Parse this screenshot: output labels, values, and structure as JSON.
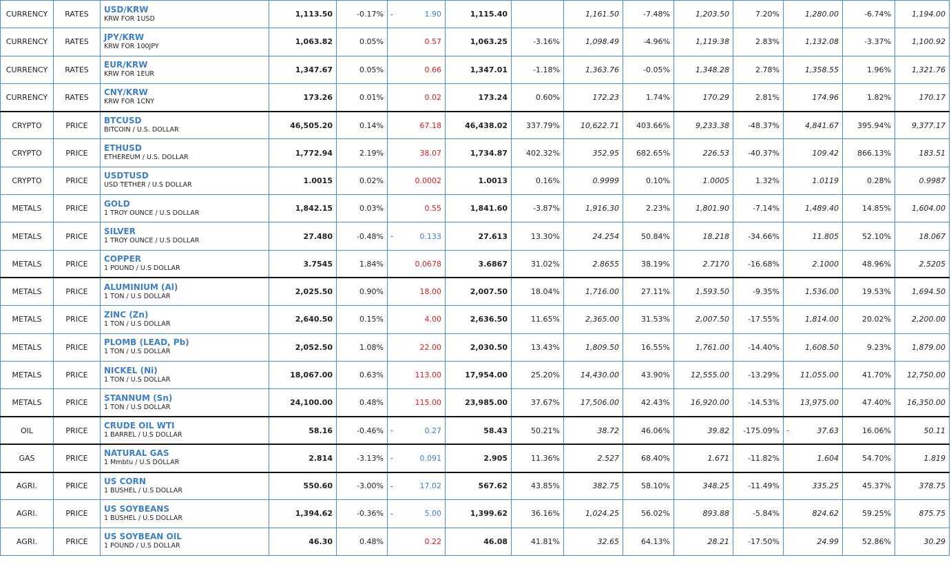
{
  "colors": {
    "positive": "#e0191e",
    "negative": "#3d7fc9",
    "name": "#3d7fc9",
    "grid": "#4a8fd6"
  },
  "rows": [
    {
      "cat": "CURRENCY",
      "kind": "RATES",
      "name": "USD/KRW",
      "sub": "KRW FOR 1USD",
      "price": "1,113.50",
      "chg_pct": "-0.17%",
      "chg_dash": "-",
      "chg": "1.90",
      "prev": "1,115.40",
      "p1_pct": "",
      "p1_val": "1,161.50",
      "p2_pct": "-7.48%",
      "p2_dash": "",
      "p2_val": "1,203.50",
      "p3_pct": "7.20%",
      "p3_dash": "",
      "p3_val": "1,280.00",
      "p4_pct": "-6.74%",
      "p4_val": "1,194.00",
      "sep": false
    },
    {
      "cat": "CURRENCY",
      "kind": "RATES",
      "name": "JPY/KRW",
      "sub": "KRW FOR 100JPY",
      "price": "1,063.82",
      "chg_pct": "0.05%",
      "chg_dash": "",
      "chg": "0.57",
      "prev": "1,063.25",
      "p1_pct": "-3.16%",
      "p1_val": "1,098.49",
      "p2_pct": "-4.96%",
      "p2_dash": "",
      "p2_val": "1,119.38",
      "p3_pct": "2.83%",
      "p3_dash": "",
      "p3_val": "1,132.08",
      "p4_pct": "-3.37%",
      "p4_val": "1,100.92",
      "sep": false
    },
    {
      "cat": "CURRENCY",
      "kind": "RATES",
      "name": "EUR/KRW",
      "sub": "KRW FOR 1EUR",
      "price": "1,347.67",
      "chg_pct": "0.05%",
      "chg_dash": "",
      "chg": "0.66",
      "prev": "1,347.01",
      "p1_pct": "-1.18%",
      "p1_val": "1,363.76",
      "p2_pct": "-0.05%",
      "p2_dash": "",
      "p2_val": "1,348.28",
      "p3_pct": "2.78%",
      "p3_dash": "",
      "p3_val": "1,358.55",
      "p4_pct": "1.96%",
      "p4_val": "1,321.76",
      "sep": false
    },
    {
      "cat": "CURRENCY",
      "kind": "RATES",
      "name": "CNY/KRW",
      "sub": "KRW FOR 1CNY",
      "price": "173.26",
      "chg_pct": "0.01%",
      "chg_dash": "",
      "chg": "0.02",
      "prev": "173.24",
      "p1_pct": "0.60%",
      "p1_val": "172.23",
      "p2_pct": "1.74%",
      "p2_dash": "",
      "p2_val": "170.29",
      "p3_pct": "2.81%",
      "p3_dash": "",
      "p3_val": "174.96",
      "p4_pct": "1.82%",
      "p4_val": "170.17",
      "sep": false
    },
    {
      "cat": "CRYPTO",
      "kind": "PRICE",
      "name": "BTCUSD",
      "sub": "BITCOIN / U.S. DOLLAR",
      "price": "46,505.20",
      "chg_pct": "0.14%",
      "chg_dash": "",
      "chg": "67.18",
      "prev": "46,438.02",
      "p1_pct": "337.79%",
      "p1_val": "10,622.71",
      "p2_pct": "403.66%",
      "p2_dash": "",
      "p2_val": "9,233.38",
      "p3_pct": "-48.37%",
      "p3_dash": "",
      "p3_val": "4,841.67",
      "p4_pct": "395.94%",
      "p4_val": "9,377.17",
      "sep": true
    },
    {
      "cat": "CRYPTO",
      "kind": "PRICE",
      "name": "ETHUSD",
      "sub": "ETHEREUM / U.S. DOLLAR",
      "price": "1,772.94",
      "chg_pct": "2.19%",
      "chg_dash": "",
      "chg": "38.07",
      "prev": "1,734.87",
      "p1_pct": "402.32%",
      "p1_val": "352.95",
      "p2_pct": "682.65%",
      "p2_dash": "",
      "p2_val": "226.53",
      "p3_pct": "-40.37%",
      "p3_dash": "",
      "p3_val": "109.42",
      "p4_pct": "866.13%",
      "p4_val": "183.51",
      "sep": false
    },
    {
      "cat": "CRYPTO",
      "kind": "PRICE",
      "name": "USDTUSD",
      "sub": "USD TETHER / U.S DOLLAR",
      "price": "1.0015",
      "chg_pct": "0.02%",
      "chg_dash": "",
      "chg": "0.0002",
      "prev": "1.0013",
      "p1_pct": "0.16%",
      "p1_val": "0.9999",
      "p2_pct": "0.10%",
      "p2_dash": "",
      "p2_val": "1.0005",
      "p3_pct": "1.32%",
      "p3_dash": "",
      "p3_val": "1.0119",
      "p4_pct": "0.28%",
      "p4_val": "0.9987",
      "sep": false
    },
    {
      "cat": "METALS",
      "kind": "PRICE",
      "name": "GOLD",
      "sub": "1 TROY OUNCE / U.S DOLLAR",
      "price": "1,842.15",
      "chg_pct": "0.03%",
      "chg_dash": "",
      "chg": "0.55",
      "prev": "1,841.60",
      "p1_pct": "-3.87%",
      "p1_val": "1,916.30",
      "p2_pct": "2.23%",
      "p2_dash": "",
      "p2_val": "1,801.90",
      "p3_pct": "-7.14%",
      "p3_dash": "",
      "p3_val": "1,489.40",
      "p4_pct": "14.85%",
      "p4_val": "1,604.00",
      "sep": false
    },
    {
      "cat": "METALS",
      "kind": "PRICE",
      "name": "SILVER",
      "sub": "1 TROY OUNCE / U.S DOLLAR",
      "price": "27.480",
      "chg_pct": "-0.48%",
      "chg_dash": "-",
      "chg": "0.133",
      "prev": "27.613",
      "p1_pct": "13.30%",
      "p1_val": "24.254",
      "p2_pct": "50.84%",
      "p2_dash": "",
      "p2_val": "18.218",
      "p3_pct": "-34.66%",
      "p3_dash": "",
      "p3_val": "11.805",
      "p4_pct": "52.10%",
      "p4_val": "18.067",
      "sep": false
    },
    {
      "cat": "METALS",
      "kind": "PRICE",
      "name": "COPPER",
      "sub": "1 POUND / U.S DOLLAR",
      "price": "3.7545",
      "chg_pct": "1.84%",
      "chg_dash": "",
      "chg": "0.0678",
      "prev": "3.6867",
      "p1_pct": "31.02%",
      "p1_val": "2.8655",
      "p2_pct": "38.19%",
      "p2_dash": "",
      "p2_val": "2.7170",
      "p3_pct": "-16.68%",
      "p3_dash": "",
      "p3_val": "2.1000",
      "p4_pct": "48.96%",
      "p4_val": "2.5205",
      "sep": false
    },
    {
      "cat": "METALS",
      "kind": "PRICE",
      "name": "ALUMINIUM (Al)",
      "sub": "1 TON / U.S DOLLAR",
      "price": "2,025.50",
      "chg_pct": "0.90%",
      "chg_dash": "",
      "chg": "18.00",
      "prev": "2,007.50",
      "p1_pct": "18.04%",
      "p1_val": "1,716.00",
      "p2_pct": "27.11%",
      "p2_dash": "",
      "p2_val": "1,593.50",
      "p3_pct": "-9.35%",
      "p3_dash": "",
      "p3_val": "1,536.00",
      "p4_pct": "19.53%",
      "p4_val": "1,694.50",
      "sep": true
    },
    {
      "cat": "METALS",
      "kind": "PRICE",
      "name": "ZINC (Zn)",
      "sub": "1 TON / U.S DOLLAR",
      "price": "2,640.50",
      "chg_pct": "0.15%",
      "chg_dash": "",
      "chg": "4.00",
      "prev": "2,636.50",
      "p1_pct": "11.65%",
      "p1_val": "2,365.00",
      "p2_pct": "31.53%",
      "p2_dash": "",
      "p2_val": "2,007.50",
      "p3_pct": "-17.55%",
      "p3_dash": "",
      "p3_val": "1,814.00",
      "p4_pct": "20.02%",
      "p4_val": "2,200.00",
      "sep": false
    },
    {
      "cat": "METALS",
      "kind": "PRICE",
      "name": "PLOMB (LEAD, Pb)",
      "sub": "1 TON / U.S DOLLAR",
      "price": "2,052.50",
      "chg_pct": "1.08%",
      "chg_dash": "",
      "chg": "22.00",
      "prev": "2,030.50",
      "p1_pct": "13.43%",
      "p1_val": "1,809.50",
      "p2_pct": "16.55%",
      "p2_dash": "",
      "p2_val": "1,761.00",
      "p3_pct": "-14.40%",
      "p3_dash": "",
      "p3_val": "1,608.50",
      "p4_pct": "9.23%",
      "p4_val": "1,879.00",
      "sep": false
    },
    {
      "cat": "METALS",
      "kind": "PRICE",
      "name": "NICKEL (Ni)",
      "sub": "1 TON / U.S DOLLAR",
      "price": "18,067.00",
      "chg_pct": "0.63%",
      "chg_dash": "",
      "chg": "113.00",
      "prev": "17,954.00",
      "p1_pct": "25.20%",
      "p1_val": "14,430.00",
      "p2_pct": "43.90%",
      "p2_dash": "",
      "p2_val": "12,555.00",
      "p3_pct": "-13.29%",
      "p3_dash": "",
      "p3_val": "11,055.00",
      "p4_pct": "41.70%",
      "p4_val": "12,750.00",
      "sep": false
    },
    {
      "cat": "METALS",
      "kind": "PRICE",
      "name": "STANNUM (Sn)",
      "sub": "1 TON / U.S DOLLAR",
      "price": "24,100.00",
      "chg_pct": "0.48%",
      "chg_dash": "",
      "chg": "115.00",
      "prev": "23,985.00",
      "p1_pct": "37.67%",
      "p1_val": "17,506.00",
      "p2_pct": "42.43%",
      "p2_dash": "",
      "p2_val": "16,920.00",
      "p3_pct": "-14.53%",
      "p3_dash": "",
      "p3_val": "13,975.00",
      "p4_pct": "47.40%",
      "p4_val": "16,350.00",
      "sep": false
    },
    {
      "cat": "OIL",
      "kind": "PRICE",
      "name": "CRUDE OIL WTI",
      "sub": "1 BARREL / U.S DOLLAR",
      "price": "58.16",
      "chg_pct": "-0.46%",
      "chg_dash": "-",
      "chg": "0.27",
      "prev": "58.43",
      "p1_pct": "50.21%",
      "p1_val": "38.72",
      "p2_pct": "46.06%",
      "p2_dash": "",
      "p2_val": "39.82",
      "p3_pct": "-175.09%",
      "p3_dash": "-",
      "p3_val": "37.63",
      "p4_pct": "16.06%",
      "p4_val": "50.11",
      "sep": true
    },
    {
      "cat": "GAS",
      "kind": "PRICE",
      "name": "NATURAL GAS",
      "sub": "1 Mmbtu / U.S DOLLAR",
      "price": "2.814",
      "chg_pct": "-3.13%",
      "chg_dash": "-",
      "chg": "0.091",
      "prev": "2.905",
      "p1_pct": "11.36%",
      "p1_val": "2.527",
      "p2_pct": "68.40%",
      "p2_dash": "",
      "p2_val": "1.671",
      "p3_pct": "-11.82%",
      "p3_dash": "",
      "p3_val": "1.604",
      "p4_pct": "54.70%",
      "p4_val": "1.819",
      "sep": true
    },
    {
      "cat": "AGRI.",
      "kind": "PRICE",
      "name": "US CORN",
      "sub": "1 BUSHEL / U.S DOLLAR",
      "price": "550.60",
      "chg_pct": "-3.00%",
      "chg_dash": "-",
      "chg": "17.02",
      "prev": "567.62",
      "p1_pct": "43.85%",
      "p1_val": "382.75",
      "p2_pct": "58.10%",
      "p2_dash": "",
      "p2_val": "348.25",
      "p3_pct": "-11.49%",
      "p3_dash": "",
      "p3_val": "335.25",
      "p4_pct": "45.37%",
      "p4_val": "378.75",
      "sep": true
    },
    {
      "cat": "AGRI.",
      "kind": "PRICE",
      "name": "US SOYBEANS",
      "sub": "1 BUSHEL / U.S DOLLAR",
      "price": "1,394.62",
      "chg_pct": "-0.36%",
      "chg_dash": "-",
      "chg": "5.00",
      "prev": "1,399.62",
      "p1_pct": "36.16%",
      "p1_val": "1,024.25",
      "p2_pct": "56.02%",
      "p2_dash": "",
      "p2_val": "893.88",
      "p3_pct": "-5.84%",
      "p3_dash": "",
      "p3_val": "824.62",
      "p4_pct": "59.25%",
      "p4_val": "875.75",
      "sep": false
    },
    {
      "cat": "AGRI.",
      "kind": "PRICE",
      "name": "US SOYBEAN OIL",
      "sub": "1 POUND / U.S DOLLAR",
      "price": "46.30",
      "chg_pct": "0.48%",
      "chg_dash": "",
      "chg": "0.22",
      "prev": "46.08",
      "p1_pct": "41.81%",
      "p1_val": "32.65",
      "p2_pct": "64.13%",
      "p2_dash": "",
      "p2_val": "28.21",
      "p3_pct": "-17.50%",
      "p3_dash": "",
      "p3_val": "24.99",
      "p4_pct": "52.86%",
      "p4_val": "30.29",
      "sep": false
    }
  ]
}
